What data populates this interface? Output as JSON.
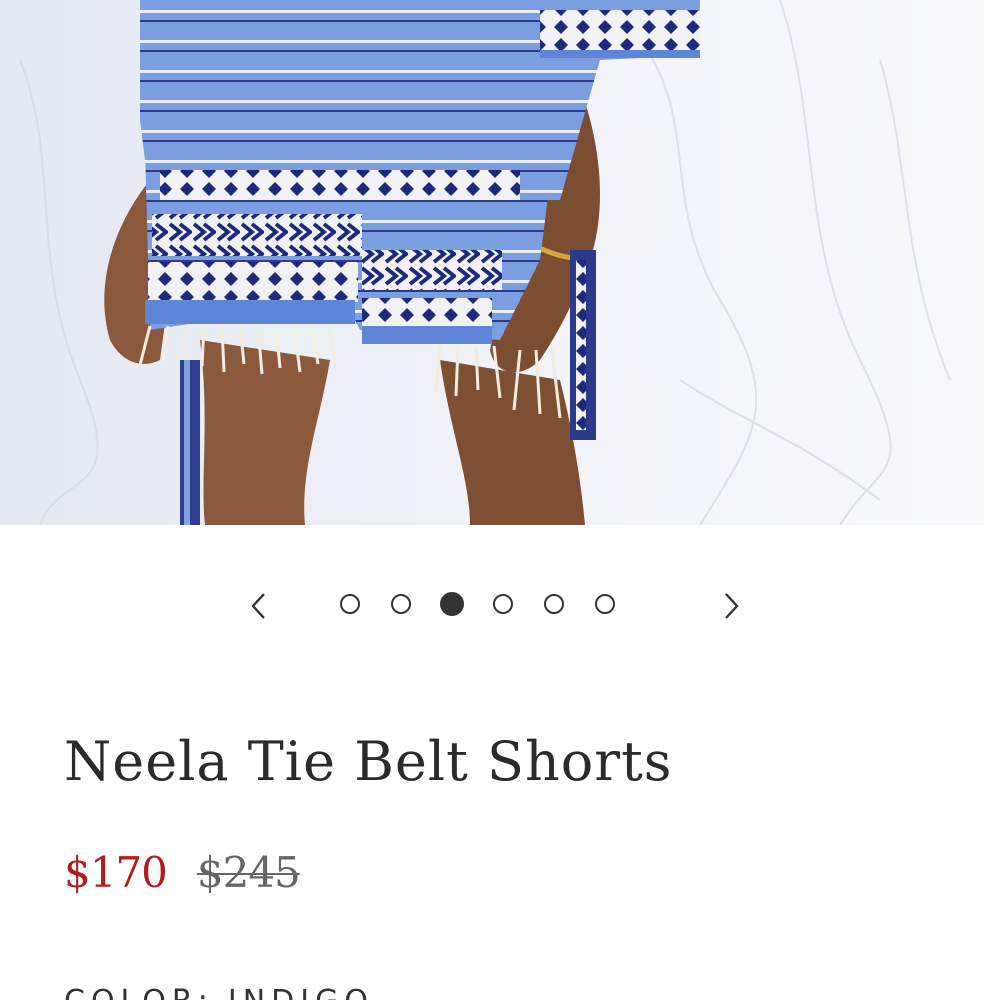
{
  "product": {
    "title": "Neela Tie Belt Shorts",
    "price_sale": "$170",
    "price_original": "$245",
    "color_label": "COLOR:",
    "color_value": "INDIGO"
  },
  "carousel": {
    "prev_icon": "chevron-left-icon",
    "next_icon": "chevron-right-icon",
    "total_images": 6,
    "active_index": 3
  },
  "colors": {
    "sale_price": "#b01d1d",
    "title": "#2b2b2b",
    "fabric_blue": "#6f93d8",
    "fabric_navy": "#1f2a7a"
  }
}
